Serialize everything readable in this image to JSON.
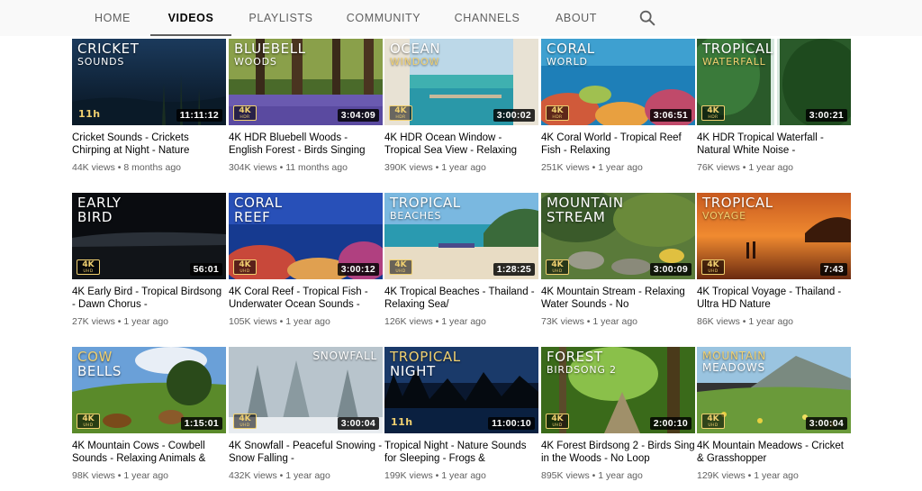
{
  "tabs": [
    {
      "label": "HOME"
    },
    {
      "label": "VIDEOS"
    },
    {
      "label": "PLAYLISTS"
    },
    {
      "label": "COMMUNITY"
    },
    {
      "label": "CHANNELS"
    },
    {
      "label": "ABOUT"
    }
  ],
  "active_tab": "VIDEOS",
  "search_icon": "search-icon",
  "colors": {
    "tab_bar_bg": "#f9f9f9",
    "badge_gold": "#f0d070",
    "duration_bg": "#000000"
  },
  "videos": [
    {
      "thumb_line1": "CRICKET",
      "thumb_line2": "SOUNDS",
      "badge": "",
      "hours_tag": "11h",
      "duration": "11:11:12",
      "title": "Cricket Sounds - Crickets Chirping at Night - Nature",
      "views": "44K views",
      "age": "8 months ago"
    },
    {
      "thumb_line1": "BLUEBELL",
      "thumb_line2": "WOODS",
      "badge": "4K HDR",
      "hours_tag": "",
      "duration": "3:04:09",
      "title": "4K HDR Bluebell Woods - English Forest - Birds Singing",
      "views": "304K views",
      "age": "11 months ago"
    },
    {
      "thumb_line1": "OCEAN",
      "thumb_line2": "WINDOW",
      "badge": "4K HDR",
      "hours_tag": "",
      "duration": "3:00:02",
      "title": "4K HDR Ocean Window - Tropical Sea View - Relaxing",
      "views": "390K views",
      "age": "1 year ago"
    },
    {
      "thumb_line1": "CORAL",
      "thumb_line2": "WORLD",
      "badge": "4K HDR",
      "hours_tag": "",
      "duration": "3:06:51",
      "title": "4K Coral World - Tropical Reef Fish - Relaxing",
      "views": "251K views",
      "age": "1 year ago"
    },
    {
      "thumb_line1": "TROPICAL",
      "thumb_line2": "WATERFALL",
      "badge": "4K HDR",
      "hours_tag": "",
      "duration": "3:00:21",
      "title": "4K HDR Tropical Waterfall - Natural White Noise -",
      "views": "76K views",
      "age": "1 year ago"
    },
    {
      "thumb_line1": "EARLY",
      "thumb_line2": "BIRD",
      "badge": "4K UHD",
      "hours_tag": "",
      "duration": "56:01",
      "title": "4K Early Bird - Tropical Birdsong - Dawn Chorus -",
      "views": "27K views",
      "age": "1 year ago"
    },
    {
      "thumb_line1": "CORAL",
      "thumb_line2": "REEF",
      "badge": "4K UHD",
      "hours_tag": "",
      "duration": "3:00:12",
      "title": "4K Coral Reef - Tropical Fish - Underwater Ocean Sounds -",
      "views": "105K views",
      "age": "1 year ago"
    },
    {
      "thumb_line1": "TROPICAL",
      "thumb_line2": "BEACHES",
      "badge": "4K UHD",
      "hours_tag": "",
      "duration": "1:28:25",
      "title": "4K Tropical Beaches - Thailand - Relaxing Sea/",
      "views": "126K views",
      "age": "1 year ago"
    },
    {
      "thumb_line1": "MOUNTAIN",
      "thumb_line2": "STREAM",
      "badge": "4K UHD",
      "hours_tag": "",
      "duration": "3:00:09",
      "title": "4K Mountain Stream - Relaxing Water Sounds - No",
      "views": "73K views",
      "age": "1 year ago"
    },
    {
      "thumb_line1": "TROPICAL",
      "thumb_line2": "VOYAGE",
      "badge": "4K UHD",
      "hours_tag": "",
      "duration": "7:43",
      "title": "4K Tropical Voyage - Thailand - Ultra HD Nature",
      "views": "86K views",
      "age": "1 year ago"
    },
    {
      "thumb_line1": "COW",
      "thumb_line2": "BELLS",
      "badge": "4K UHD",
      "hours_tag": "",
      "duration": "1:15:01",
      "title": "4K Mountain Cows - Cowbell Sounds - Relaxing Animals &",
      "views": "98K views",
      "age": "1 year ago"
    },
    {
      "thumb_line1": "SNOWFALL",
      "thumb_line2": "",
      "badge": "4K UHD",
      "hours_tag": "",
      "duration": "3:00:04",
      "title": "4K Snowfall - Peaceful Snowing - Snow Falling -",
      "views": "432K views",
      "age": "1 year ago"
    },
    {
      "thumb_line1": "TROPICAL",
      "thumb_line2": "NIGHT",
      "badge": "",
      "hours_tag": "11h",
      "duration": "11:00:10",
      "title": "Tropical Night - Nature Sounds for Sleeping - Frogs &",
      "views": "199K views",
      "age": "1 year ago"
    },
    {
      "thumb_line1": "FOREST",
      "thumb_line2": "BIRDSONG 2",
      "badge": "4K UHD",
      "hours_tag": "",
      "duration": "2:00:10",
      "title": "4K Forest Birdsong 2 - Birds Sing in the Woods - No Loop",
      "views": "895K views",
      "age": "1 year ago"
    },
    {
      "thumb_line1": "MOUNTAIN",
      "thumb_line2": "MEADOWS",
      "badge": "4K UHD",
      "hours_tag": "",
      "duration": "3:00:04",
      "title": "4K Mountain Meadows - Cricket & Grasshopper",
      "views": "129K views",
      "age": "1 year ago"
    }
  ]
}
